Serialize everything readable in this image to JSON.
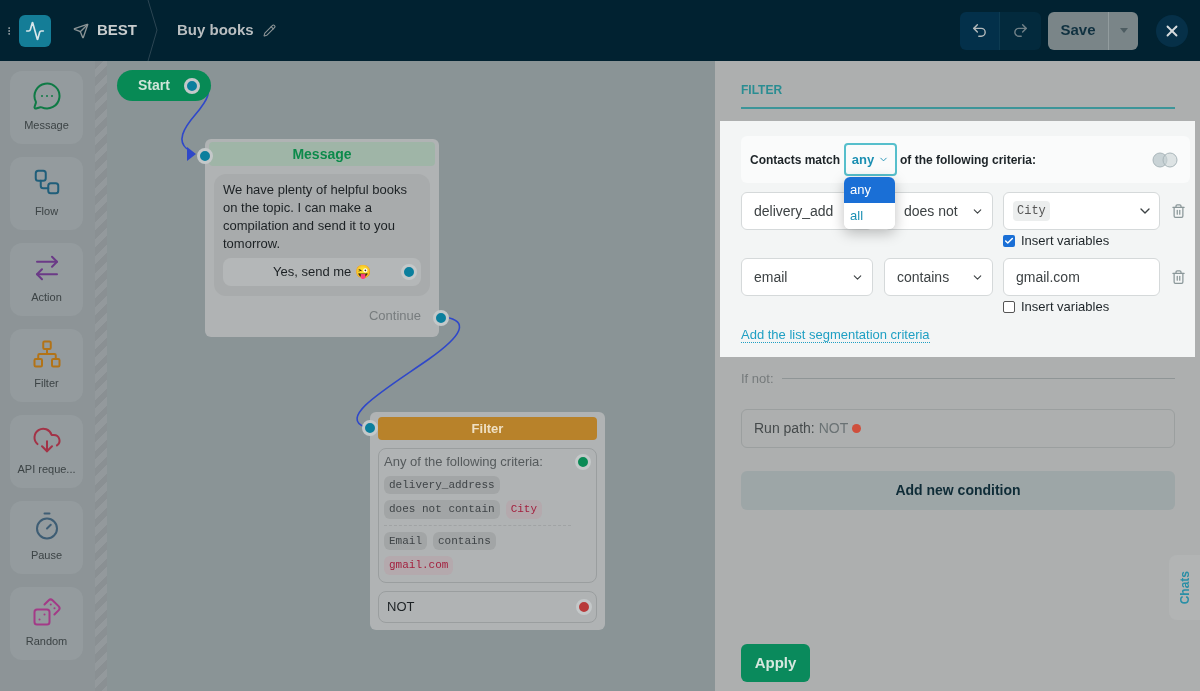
{
  "header": {
    "channel": "BEST",
    "title": "Buy books",
    "save": "Save"
  },
  "palette": [
    {
      "kind": "message",
      "label": "Message"
    },
    {
      "kind": "flow",
      "label": "Flow"
    },
    {
      "kind": "action",
      "label": "Action"
    },
    {
      "kind": "filter",
      "label": "Filter"
    },
    {
      "kind": "api",
      "label": "API reque..."
    },
    {
      "kind": "pause",
      "label": "Pause"
    },
    {
      "kind": "random",
      "label": "Random"
    }
  ],
  "canvas": {
    "start": "Start",
    "message_node": {
      "title": "Message",
      "text": "We have plenty of helpful books on the topic. I can make a compilation and send it to you tomorrow.",
      "button": "Yes, send me 😜",
      "continue": "Continue"
    },
    "filter_node": {
      "title": "Filter",
      "criteria_label": "Any of the following criteria:",
      "conditions": [
        [
          {
            "kind": "field",
            "text": "delivery_address"
          },
          {
            "kind": "operator",
            "text": "does not contain"
          },
          {
            "kind": "value",
            "text": "City"
          }
        ],
        [
          {
            "kind": "field",
            "text": "Email"
          },
          {
            "kind": "operator",
            "text": "contains"
          },
          {
            "kind": "value",
            "text": "gmail.com"
          }
        ]
      ],
      "not_path": "NOT"
    }
  },
  "panel": {
    "title": "FILTER",
    "match": {
      "prefix": "Contacts match",
      "value": "any",
      "suffix": "of the following criteria:",
      "options": [
        {
          "label": "any",
          "selected": true
        },
        {
          "label": "all",
          "selected": false
        }
      ]
    },
    "rules": [
      {
        "field": "delivery_add",
        "operator": "does not",
        "value": "City",
        "kind": "variable",
        "insert_label": "Insert variables",
        "insert_variables": true
      },
      {
        "field": "email",
        "operator": "contains",
        "value": "gmail.com",
        "kind": "text",
        "insert_label": "Insert variables",
        "insert_variables": false
      }
    ],
    "add_link": "Add the list segmentation criteria",
    "if_not": "If not:",
    "run_path": {
      "label": "Run path:",
      "value": "NOT"
    },
    "add_condition": "Add new condition",
    "apply": "Apply",
    "chats": "Chats"
  }
}
